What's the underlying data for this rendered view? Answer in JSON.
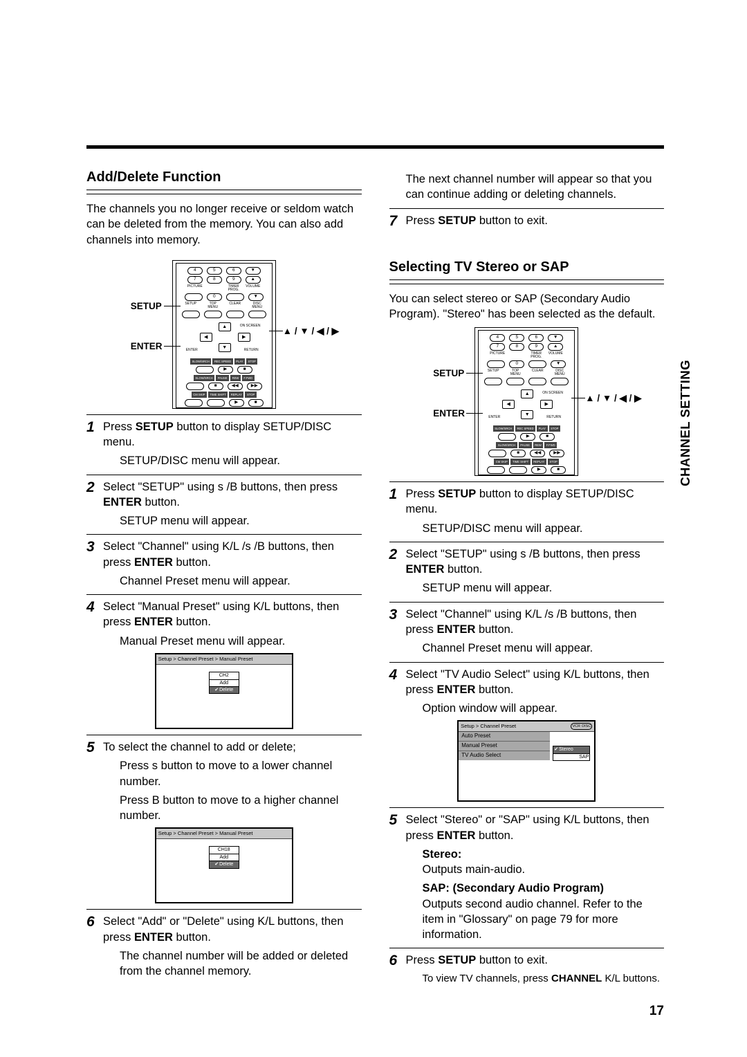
{
  "sideLabel": "CHANNEL SETTING",
  "pageNumber": "17",
  "left": {
    "title": "Add/Delete Function",
    "intro": "The channels you no longer receive or seldom watch can be deleted from the memory. You can also add channels into memory.",
    "remoteLabels": {
      "setup": "SETUP",
      "enter": "ENTER",
      "arrows": "▲ / ▼ / ◀ / ▶"
    },
    "s1a": "Press ",
    "s1b": " button to display SETUP/DISC menu.",
    "s1c": "SETUP/DISC menu will appear.",
    "s2a": "Select \"SETUP\" using s /B  buttons, then press ",
    "s2b": " button.",
    "s2c": "SETUP menu will appear.",
    "s3a": "Select \"Channel\" using K/L /s /B  buttons, then press ",
    "s3b": " button.",
    "s3c": "Channel Preset menu will appear.",
    "s4a": "Select \"Manual Preset\" using K/L  buttons, then press ",
    "s4b": " button.",
    "s4c": "Manual Preset menu will appear.",
    "osd1": {
      "crumb": "Setup > Channel Preset > Manual Preset",
      "ch": "CH2",
      "add": "Add",
      "del": "Delete"
    },
    "s5a": "To select the channel to add or delete;",
    "s5b": "Press s  button to move to a lower channel number.",
    "s5c": "Press B  button to move to a higher channel number.",
    "osd2": {
      "crumb": "Setup > Channel Preset > Manual Preset",
      "ch": "CH18",
      "add": "Add",
      "del": "Delete"
    },
    "s6a": "Select \"Add\" or \"Delete\" using K/L  buttons, then press ",
    "s6b": " button.",
    "s6c": "The channel number will be added or deleted from the channel memory.",
    "bold": {
      "setup": "SETUP",
      "enter": "ENTER"
    }
  },
  "right": {
    "topA": "The next channel number will appear so that you can continue adding or deleting channels.",
    "s7a": "Press ",
    "s7b": " button to exit.",
    "title": "Selecting TV Stereo or SAP",
    "intro": "You can select stereo or SAP (Secondary Audio Program). \"Stereo\" has been selected as the default.",
    "remoteLabels": {
      "setup": "SETUP",
      "enter": "ENTER",
      "arrows": "▲ / ▼ / ◀ / ▶"
    },
    "s1a": "Press ",
    "s1b": " button to display SETUP/DISC menu.",
    "s1c": "SETUP/DISC menu will appear.",
    "s2a": "Select \"SETUP\" using s /B  buttons, then press ",
    "s2b": " button.",
    "s2c": "SETUP menu will appear.",
    "s3a": "Select \"Channel\" using K/L /s /B  buttons, then press ",
    "s3b": " button.",
    "s3c": "Channel Preset menu will appear.",
    "s4a": "Select \"TV Audio Select\" using K/L  buttons, then press ",
    "s4b": " button.",
    "s4c": "Option window will appear.",
    "osd": {
      "crumb": "Setup > Channel Preset",
      "badgeA": "VCR",
      "badgeB": "DISC",
      "list": [
        "Auto Preset",
        "Manual Preset",
        "TV Audio Select"
      ],
      "optA": "Stereo",
      "optB": "SAP"
    },
    "s5a": "Select \"Stereo\" or \"SAP\" using K/L  buttons, then press ",
    "s5b": " button.",
    "s5head1": "Stereo:",
    "s5c": "Outputs main-audio.",
    "s5head2": "SAP: (Secondary Audio Program)",
    "s5d": "Outputs second audio channel. Refer to the item in \"Glossary\" on page 79 for more information.",
    "s6a": "Press ",
    "s6b": " button to exit.",
    "s6c": "To view TV channels, press ",
    "s6d": " K/L  buttons.",
    "bold": {
      "setup": "SETUP",
      "enter": "ENTER",
      "channel": "CHANNEL"
    }
  },
  "remoteBtns": {
    "nums": [
      "4",
      "5",
      "6",
      "7",
      "8",
      "9",
      "0"
    ],
    "smallRows": [
      [
        "PICTURE",
        "",
        "TIMER PROG.",
        "VOLUME"
      ],
      [
        "SETUP",
        "TOP MENU",
        "CLEAR",
        "DISC MENU"
      ]
    ],
    "navSmall": {
      "enter": "ENTER",
      "onscreen": "ON SCREEN",
      "return": "RETURN"
    },
    "strips": [
      [
        "SLOW/SRCH",
        "REC SPEED",
        "PLAY",
        "STOP"
      ],
      [
        "SLOW/SRCH",
        "PAUSE",
        "REW",
        "F.FWD"
      ],
      [
        "CM SKIP",
        "TIME SHIFT",
        "REPLAY",
        "STOP"
      ]
    ],
    "transport": [
      "▶",
      "■",
      "◀◀",
      "▶▶",
      "●",
      "■",
      "▶",
      "■"
    ]
  }
}
